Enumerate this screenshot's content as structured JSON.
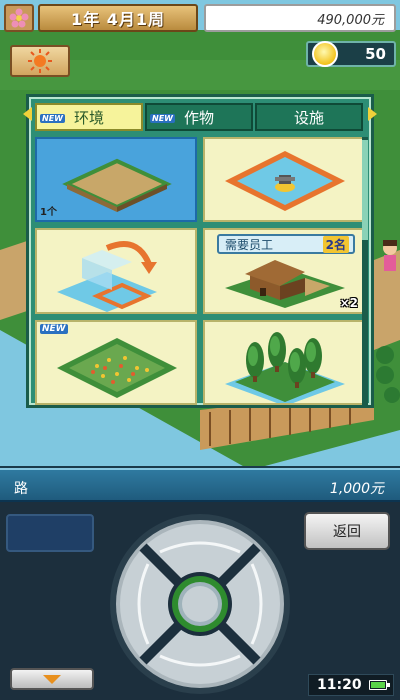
{
  "header": {
    "date": "1年 4月1周",
    "money": "490,000元"
  },
  "ideas": {
    "count": "50"
  },
  "menu": {
    "tabs": [
      {
        "label": "环境",
        "new": "NEW",
        "active": true
      },
      {
        "label": "作物",
        "new": "NEW",
        "active": false
      },
      {
        "label": "设施",
        "new": "",
        "active": false
      }
    ],
    "cards": [
      {
        "name": "road-plot-card",
        "count": "1个",
        "new": "",
        "selected": true
      },
      {
        "name": "pond-card",
        "count": "",
        "new": "",
        "selected": false
      },
      {
        "name": "move-plot-card",
        "count": "",
        "new": "",
        "selected": false
      },
      {
        "name": "farm-house-card",
        "count": "",
        "new": "",
        "selected": false,
        "staff_label": "需要员工",
        "staff_count": "2名",
        "multiplier": "×2"
      },
      {
        "name": "flower-bed-card",
        "count": "",
        "new": "NEW",
        "selected": false
      },
      {
        "name": "tree-grove-card",
        "count": "",
        "new": "",
        "selected": false
      }
    ],
    "scroll_position": 0.02
  },
  "selected_item": {
    "name": "路",
    "price": "1,000元"
  },
  "controls": {
    "back_label": "返回",
    "time": "11:20",
    "battery_level": 0.85
  },
  "colors": {
    "menu_bg": "#2d8e75",
    "card_bg": "#f4f3c4",
    "selected_card": "#49a3dc",
    "tab_active": "#f6f39b"
  }
}
